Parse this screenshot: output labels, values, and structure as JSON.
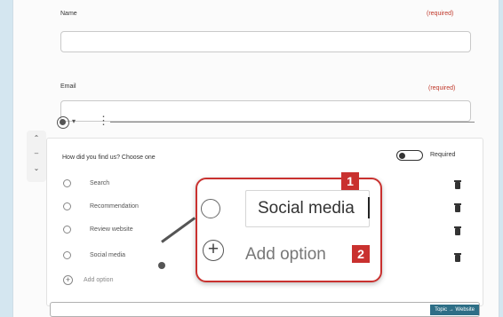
{
  "form": {
    "name_label": "Name",
    "name_required": "(required)",
    "email_label": "Email",
    "email_required": "(required)",
    "question": "How did you find us? Choose one",
    "required_label": "Required",
    "options": [
      "Search",
      "Recommendation",
      "Review website",
      "Social media"
    ],
    "add_option": "Add option",
    "bottom_tag": "Topic → Website"
  },
  "zoom": {
    "option_value": "Social media",
    "add_option": "Add option",
    "badge_1": "1",
    "badge_2": "2"
  },
  "colors": {
    "accent_red": "#c9312f",
    "background": "#d4e6f0",
    "tag_bg": "#2d6e86"
  }
}
